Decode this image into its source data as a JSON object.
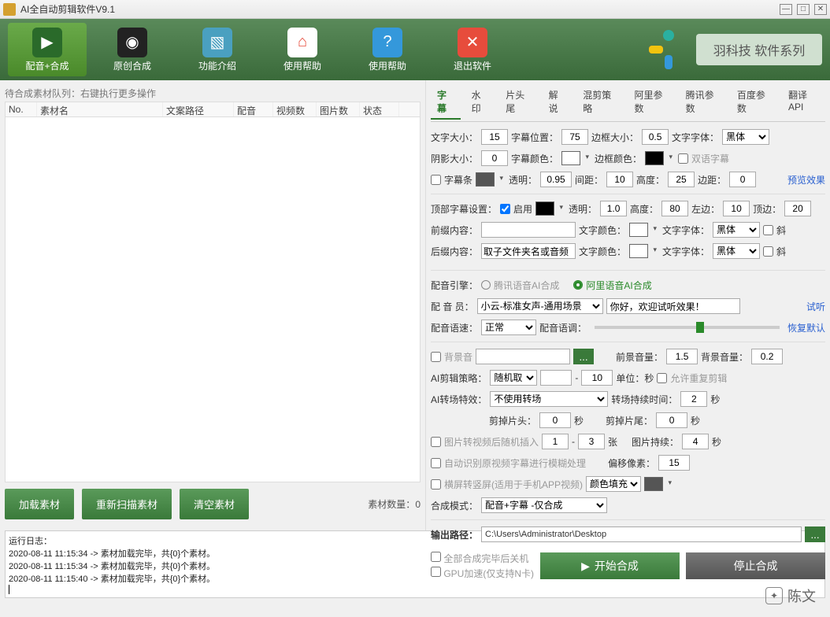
{
  "window": {
    "title": "AI全自动剪辑软件V9.1"
  },
  "toolbar": {
    "items": [
      {
        "label": "配音+合成"
      },
      {
        "label": "原创合成"
      },
      {
        "label": "功能介绍"
      },
      {
        "label": "使用帮助"
      },
      {
        "label": "退出软件"
      }
    ],
    "brand": "羽科技 软件系列"
  },
  "left": {
    "queue_label": "待合成素材队列：右键执行更多操作",
    "cols": {
      "no": "No.",
      "name": "素材名",
      "path": "文案路径",
      "dub": "配音",
      "vcount": "视频数",
      "pcount": "图片数",
      "status": "状态"
    },
    "btn_load": "加载素材",
    "btn_rescan": "重新扫描素材",
    "btn_clear": "清空素材",
    "count_label": "素材数量：",
    "count_value": "0"
  },
  "tabs": [
    "字幕",
    "水印",
    "片头尾",
    "解说",
    "混剪策略",
    "阿里参数",
    "腾讯参数",
    "百度参数",
    "翻译API"
  ],
  "subtitle": {
    "font_size_label": "文字大小：",
    "font_size": "15",
    "pos_label": "字幕位置：",
    "pos": "75",
    "border_label": "边框大小：",
    "border": "0.5",
    "font_label": "文字字体：",
    "font": "黑体",
    "shadow_label": "阴影大小：",
    "shadow": "0",
    "color_label": "字幕颜色：",
    "border_color_label": "边框颜色：",
    "bilingual": "双语字幕",
    "bar_label": "字幕条",
    "bar_alpha_label": "透明：",
    "bar_alpha": "0.95",
    "gap_label": "间距：",
    "gap": "10",
    "height_label": "高度：",
    "height": "25",
    "margin_label": "边距：",
    "margin": "0",
    "preview": "预览效果",
    "top_label": "顶部字幕设置：",
    "enable": "启用",
    "top_alpha_label": "透明：",
    "top_alpha": "1.0",
    "top_height_label": "高度：",
    "top_height": "80",
    "top_left_label": "左边：",
    "top_left": "10",
    "top_margin_label": "顶边：",
    "top_margin": "20",
    "prefix_label": "前缀内容：",
    "prefix": "",
    "text_color_label": "文字颜色：",
    "text_font_label": "文字字体：",
    "text_font": "黑体",
    "italic": "斜",
    "suffix_label": "后缀内容：",
    "suffix": "取子文件夹名或音频"
  },
  "voice": {
    "engine_label": "配音引擎：",
    "engine_tencent": "腾讯语音AI合成",
    "engine_ali": "阿里语音AI合成",
    "voicer_label": "配 音 员：",
    "voicer": "小云-标准女声-通用场景",
    "sample_text": "你好，欢迎试听效果！",
    "try": "试听",
    "speed_label": "配音语速：",
    "speed": "正常",
    "tone_label": "配音语调：",
    "reset": "恢复默认"
  },
  "bgm": {
    "label": "背景音",
    "path": "",
    "fg_label": "前景音量：",
    "fg": "1.5",
    "bg_label": "背景音量：",
    "bg": "0.2"
  },
  "clip": {
    "strategy_label": "AI剪辑策略：",
    "strategy": "随机取",
    "from": "",
    "to": "10",
    "unit_label": "单位：秒",
    "allow_repeat": "允许重复剪辑",
    "trans_label": "AI转场特效：",
    "trans": "不使用转场",
    "trans_dur_label": "转场持续时间：",
    "trans_dur": "2",
    "sec": "秒",
    "trim_head_label": "剪掉片头：",
    "trim_head": "0",
    "trim_tail_label": "剪掉片尾：",
    "trim_tail": "0",
    "pic_insert": "图片转视频后随机插入",
    "pic_from": "1",
    "pic_to": "3",
    "zhang": "张",
    "pic_dur_label": "图片持续：",
    "pic_dur": "4",
    "blur": "自动识别原视频字幕进行模糊处理",
    "offset_label": "偏移像素：",
    "offset": "15",
    "portrait": "横屏转竖屏(适用于手机APP视频)",
    "fill": "颜色填充",
    "mode_label": "合成模式：",
    "mode": "配音+字幕 -仅合成",
    "out_label": "输出路径：",
    "out": "C:\\Users\\Administrator\\Desktop",
    "shutdown": "全部合成完毕后关机",
    "gpu": "GPU加速(仅支持N卡)",
    "start": "开始合成",
    "stop": "停止合成"
  },
  "log": {
    "header": "运行日志：",
    "lines": [
      "2020-08-11 11:15:34 -> 素材加载完毕，共{0}个素材。",
      "2020-08-11 11:15:34 -> 素材加载完毕，共{0}个素材。",
      "2020-08-11 11:15:40 -> 素材加载完毕，共{0}个素材。"
    ]
  },
  "watermark": "陈文"
}
